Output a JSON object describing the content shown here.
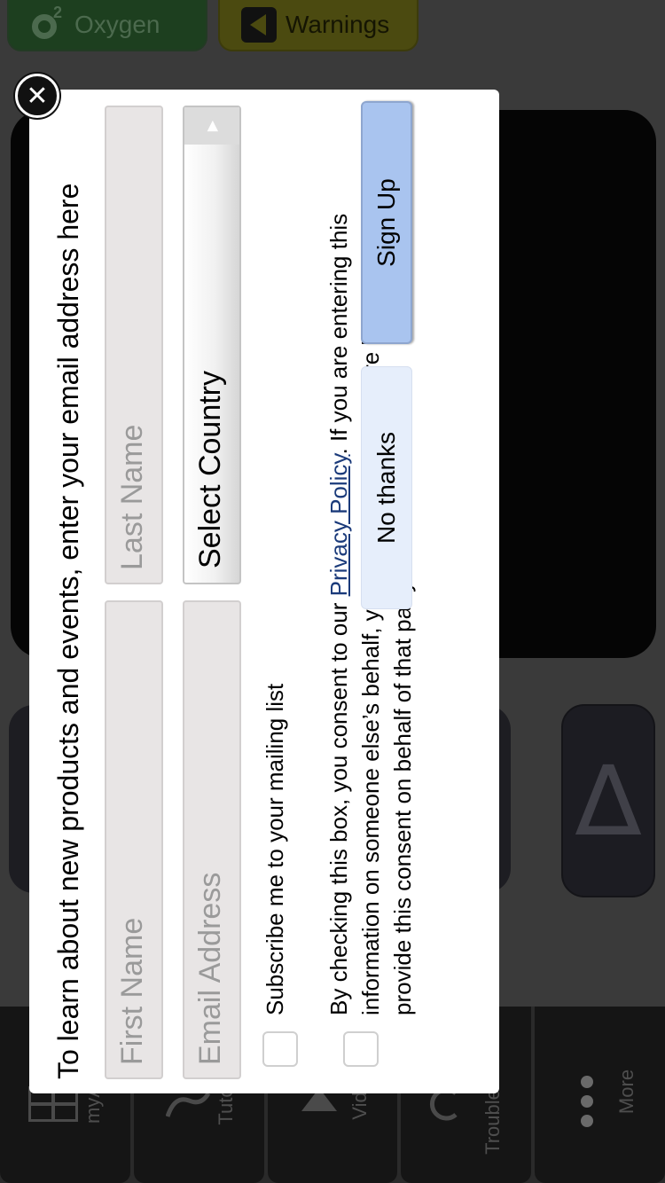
{
  "app": {
    "top_tabs": [
      {
        "label": "Oxygen",
        "icon": "o2-icon"
      },
      {
        "label": "Warnings",
        "icon": "warning-triangle-icon"
      }
    ],
    "delta_glyph": "∆",
    "bottom_nav": [
      {
        "label": "myA",
        "icon": "grid-icon"
      },
      {
        "label": "Tuto",
        "icon": "tutorial-icon"
      },
      {
        "label": "Vid",
        "icon": "video-icon"
      },
      {
        "label": "Trouble",
        "icon": "troubleshoot-icon"
      },
      {
        "label": "More",
        "icon": "more-dots-icon"
      }
    ]
  },
  "modal": {
    "intro": "To learn about new products and events, enter your email address here",
    "first_name_placeholder": "First Name",
    "last_name_placeholder": "Last Name",
    "email_placeholder": "Email Address",
    "country_select": "Select Country",
    "subscribe_label": "Subscribe me to your mailing list",
    "consent_prefix": "By checking this box, you consent to our ",
    "privacy_link": "Privacy Policy",
    "consent_suffix": ". If you are entering this information on someone else’s behalf, you represent that you are legally authorized to provide this consent on behalf of that party.",
    "no_thanks_label": "No thanks",
    "sign_up_label": "Sign Up",
    "close_glyph": "✕"
  },
  "colors": {
    "sign_up_bg": "#a9c4ef",
    "no_thanks_bg": "#e6eefb",
    "link": "#1a3a7a"
  }
}
